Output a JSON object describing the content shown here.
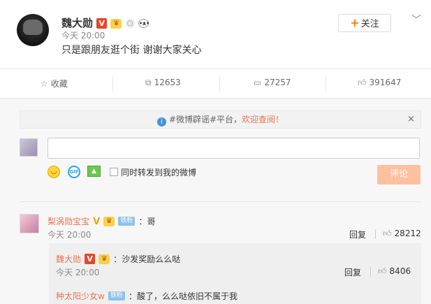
{
  "post": {
    "author": "魏大勋",
    "time": "今天 20:00",
    "text": "只是跟朋友逛个街 谢谢大家关心",
    "follow_label": "关注",
    "follow_plus": "+",
    "verified_badge": "V"
  },
  "actions": {
    "favorite_label": "收藏",
    "repost_count": "12653",
    "comment_count": "27257",
    "like_count": "391647"
  },
  "notice": {
    "prefix": "#微博辟谣#平台，",
    "link": "欢迎查阅！",
    "close": "×"
  },
  "composer": {
    "input_value": "",
    "checkbox_label": "同时转发到我的微博",
    "submit_label": "评论"
  },
  "comments": [
    {
      "name": "梨涡勋宝宝",
      "tag": "铁粉",
      "text": "：哥",
      "time": "今天 20:00",
      "reply_label": "回复",
      "likes": "28212",
      "replies": [
        {
          "name": "魏大勋",
          "text": "：沙发奖励么么哒",
          "time": "今天 20:00",
          "reply_label": "回复",
          "likes": "8406"
        },
        {
          "name": "种太阳少女w",
          "tag": "铁粉",
          "text": "：酸了，么么哒依旧不属于我"
        }
      ]
    }
  ],
  "colors": {
    "accent": "#eb7350",
    "follow_plus": "#ff8200",
    "submit_bg": "#ffc09f",
    "verified_red": "#e8462b"
  }
}
